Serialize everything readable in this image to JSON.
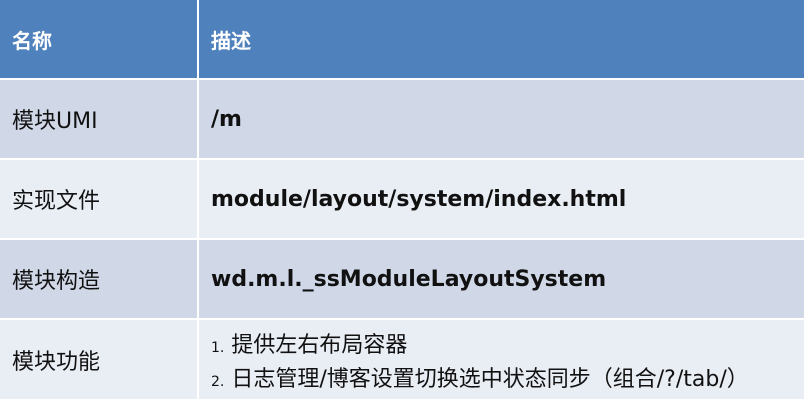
{
  "header": {
    "col1": "名称",
    "col2": "描述"
  },
  "rows": [
    {
      "name": "模块UMI",
      "desc": "/m"
    },
    {
      "name": "实现文件",
      "desc": "module/layout/system/index.html"
    },
    {
      "name": "模块构造",
      "desc": "wd.m.l._ssModuleLayoutSystem"
    },
    {
      "name": "模块功能",
      "desc_items": [
        {
          "num": "1.",
          "text": "提供左右布局容器"
        },
        {
          "num": "2.",
          "text": "日志管理/博客设置切换选中状态同步（组合/?/tab/）"
        }
      ]
    }
  ],
  "colors": {
    "header_bg": "#4f81bd",
    "row_band_1": "#d0d8e8",
    "row_band_2": "#e9edf4"
  }
}
